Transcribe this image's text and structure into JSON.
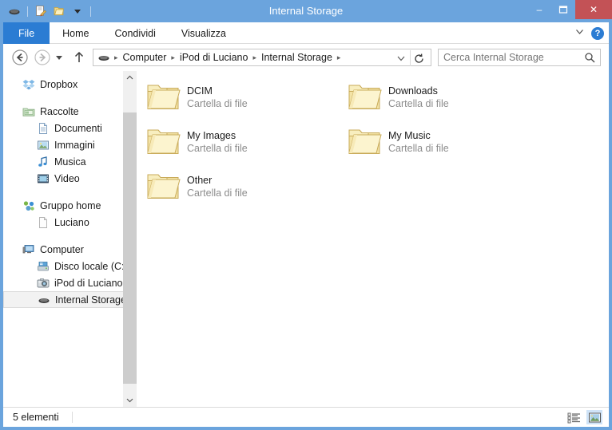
{
  "window": {
    "title": "Internal Storage",
    "accent_blue": "#6ba4dd",
    "tab_blue": "#2b7cd3",
    "close_red": "#c35256",
    "controls": {
      "minimize": "–",
      "maximize": "❐",
      "close": "✕"
    }
  },
  "quick_access": {
    "device_icon": "device-icon",
    "properties_icon": "properties-icon",
    "new_folder_icon": "new-folder-icon",
    "dropdown_icon": "chevron-down-icon"
  },
  "ribbon": {
    "tabs": [
      {
        "label": "File",
        "active": true
      },
      {
        "label": "Home",
        "active": false
      },
      {
        "label": "Condividi",
        "active": false
      },
      {
        "label": "Visualizza",
        "active": false
      }
    ],
    "expand_icon": "chevron-down-icon",
    "help_label": "?"
  },
  "navbar": {
    "back_icon": "arrow-left-icon",
    "forward_icon": "arrow-right-icon",
    "recent_icon": "chevron-down-icon",
    "up_icon": "arrow-up-icon",
    "location_icon": "device-icon",
    "breadcrumbs": [
      "Computer",
      "iPod di Luciano",
      "Internal Storage"
    ],
    "separator": "▸",
    "dropdown_icon": "chevron-down-icon",
    "refresh_icon": "refresh-icon"
  },
  "search": {
    "placeholder": "Cerca Internal Storage",
    "value": "",
    "icon": "search-icon"
  },
  "sidebar": {
    "groups": [
      {
        "items": [
          {
            "label": "Dropbox",
            "icon": "dropbox-icon",
            "level": 0,
            "selected": false
          }
        ]
      },
      {
        "items": [
          {
            "label": "Raccolte",
            "icon": "libraries-icon",
            "level": 0,
            "selected": false
          },
          {
            "label": "Documenti",
            "icon": "documents-icon",
            "level": 1,
            "selected": false
          },
          {
            "label": "Immagini",
            "icon": "pictures-icon",
            "level": 1,
            "selected": false
          },
          {
            "label": "Musica",
            "icon": "music-icon",
            "level": 1,
            "selected": false
          },
          {
            "label": "Video",
            "icon": "video-icon",
            "level": 1,
            "selected": false
          }
        ]
      },
      {
        "items": [
          {
            "label": "Gruppo home",
            "icon": "homegroup-icon",
            "level": 0,
            "selected": false
          },
          {
            "label": "Luciano",
            "icon": "user-page-icon",
            "level": 1,
            "selected": false
          }
        ]
      },
      {
        "items": [
          {
            "label": "Computer",
            "icon": "computer-icon",
            "level": 0,
            "selected": false
          },
          {
            "label": "Disco locale (C:)",
            "icon": "harddrive-icon",
            "level": 1,
            "selected": false
          },
          {
            "label": "iPod di Luciano",
            "icon": "camera-icon",
            "level": 1,
            "selected": false
          },
          {
            "label": "Internal Storage",
            "icon": "device-icon",
            "level": 1,
            "selected": true
          }
        ]
      }
    ],
    "scrollbar": {
      "up_icon": "chevron-up-icon",
      "down_icon": "chevron-down-icon"
    }
  },
  "files": {
    "type_label": "Cartella di file",
    "items": [
      {
        "name": "DCIM",
        "type": "Cartella di file",
        "icon": "folder-icon",
        "col": 0,
        "row": 0
      },
      {
        "name": "Downloads",
        "type": "Cartella di file",
        "icon": "folder-icon",
        "col": 1,
        "row": 0
      },
      {
        "name": "My Images",
        "type": "Cartella di file",
        "icon": "folder-icon",
        "col": 0,
        "row": 1
      },
      {
        "name": "My Music",
        "type": "Cartella di file",
        "icon": "folder-icon",
        "col": 1,
        "row": 1
      },
      {
        "name": "Other",
        "type": "Cartella di file",
        "icon": "folder-icon",
        "col": 0,
        "row": 2
      }
    ]
  },
  "statusbar": {
    "item_count": "5 elementi",
    "views": [
      {
        "name": "details-view",
        "active": false
      },
      {
        "name": "large-icons-view",
        "active": true
      }
    ]
  }
}
